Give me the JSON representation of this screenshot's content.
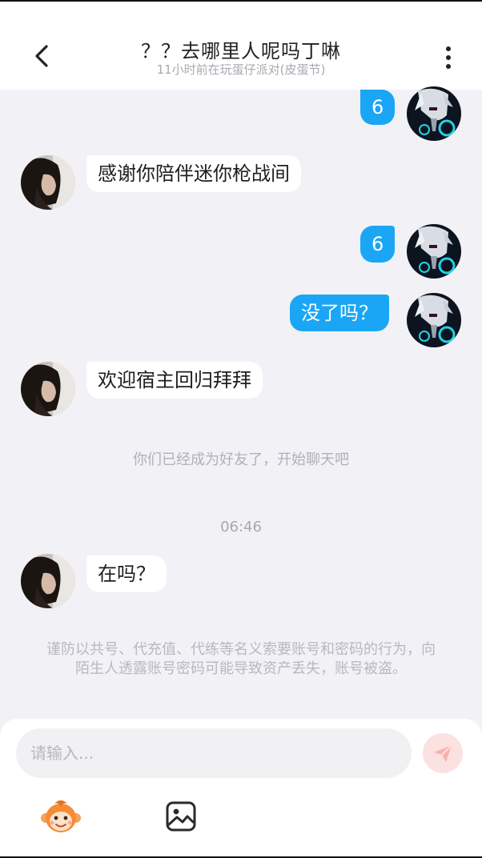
{
  "header": {
    "title": "？？去哪里人呢吗丁啉",
    "status": "11小时前在玩蛋仔派对(皮蛋节)"
  },
  "messages": [
    {
      "side": "right",
      "text": "6"
    },
    {
      "side": "left",
      "text": "感谢你陪伴迷你枪战间"
    },
    {
      "side": "right",
      "text": "6"
    },
    {
      "side": "right",
      "text": "没了吗？"
    },
    {
      "side": "left",
      "text": "欢迎宿主回归拜拜"
    },
    {
      "side": "left",
      "text": "在吗？"
    }
  ],
  "system_notice": "你们已经成为好友了，开始聊天吧",
  "timestamp": "06:46",
  "warning": "谨防以共号、代充值、代练等名义索要账号和密码的行为，向陌生人透露账号密码可能导致资产丢失，账号被盗。",
  "composer": {
    "placeholder": "请输入..."
  },
  "icons": {
    "back": "chevron-left-icon",
    "more": "more-vertical-icon",
    "send": "send-icon",
    "emoji": "monkey-emoji-icon",
    "image": "image-icon"
  },
  "colors": {
    "accent": "#1aa6f5",
    "background": "#f1f1f6",
    "send_disabled": "#fbe1e0"
  }
}
